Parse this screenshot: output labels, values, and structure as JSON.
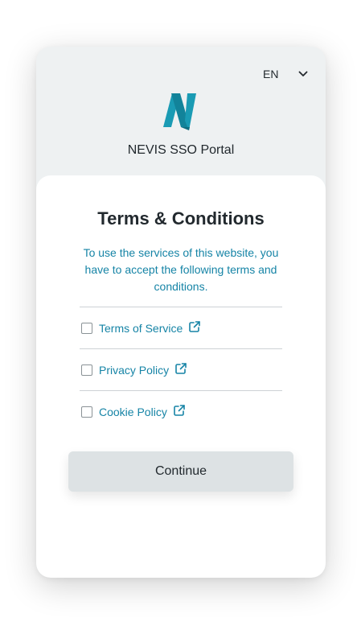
{
  "header": {
    "language": "EN",
    "portal_title": "NEVIS SSO Portal"
  },
  "terms": {
    "heading": "Terms & Conditions",
    "intro": "To use the services of this website, you have to accept the following terms and conditions.",
    "policies": [
      {
        "label": "Terms of Service",
        "checked": false
      },
      {
        "label": "Privacy Policy",
        "checked": false
      },
      {
        "label": "Cookie Policy",
        "checked": false
      }
    ],
    "continue_label": "Continue"
  },
  "colors": {
    "accent": "#1684a6",
    "logo_primary": "#1a9bb4",
    "logo_dark": "#0f6f82",
    "card_bg": "#eef1f2",
    "button_bg": "#dde2e4"
  }
}
